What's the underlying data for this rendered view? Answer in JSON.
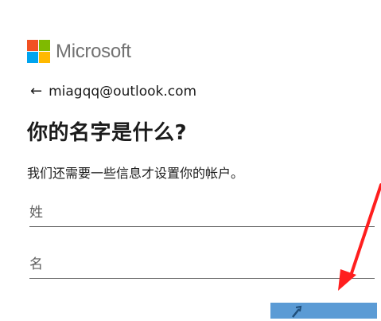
{
  "brand": {
    "name": "Microsoft",
    "colors": {
      "red": "#f25022",
      "green": "#7fba00",
      "blue": "#00a4ef",
      "yellow": "#ffb900",
      "text": "#737373"
    }
  },
  "identity": {
    "back_icon": "←",
    "email": "miagqq@outlook.com"
  },
  "title": "你的名字是什么?",
  "subtitle": "我们还需要一些信息才设置你的帐户。",
  "fields": {
    "last_name_placeholder": "姓",
    "first_name_placeholder": "名"
  },
  "buttons": {
    "next_icon": "arrow-right-icon"
  },
  "annotation": {
    "color": "#ff1e1e",
    "icon": "red-arrow-annotation-icon"
  },
  "colors": {
    "button_bg": "#5b9bd5",
    "field_border": "#666666"
  }
}
